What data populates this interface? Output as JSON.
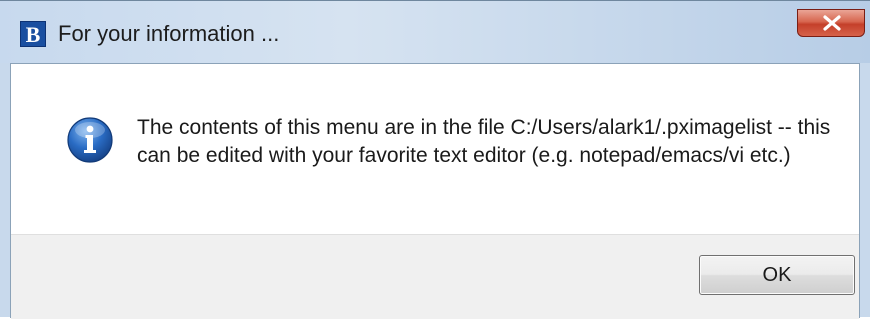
{
  "window": {
    "title": "For your information ...",
    "app_icon_letter": "B",
    "close_icon": "close-icon"
  },
  "dialog": {
    "icon": "info-icon",
    "message": "The contents of this menu are in the file C:/Users/alark1/.pximagelist -- this can be edited with your favorite text editor (e.g. notepad/emacs/vi etc.)",
    "ok_label": "OK"
  },
  "colors": {
    "info_icon": "#2a6cc4",
    "close_button": "#c4402a",
    "app_icon": "#1a4fa0"
  }
}
